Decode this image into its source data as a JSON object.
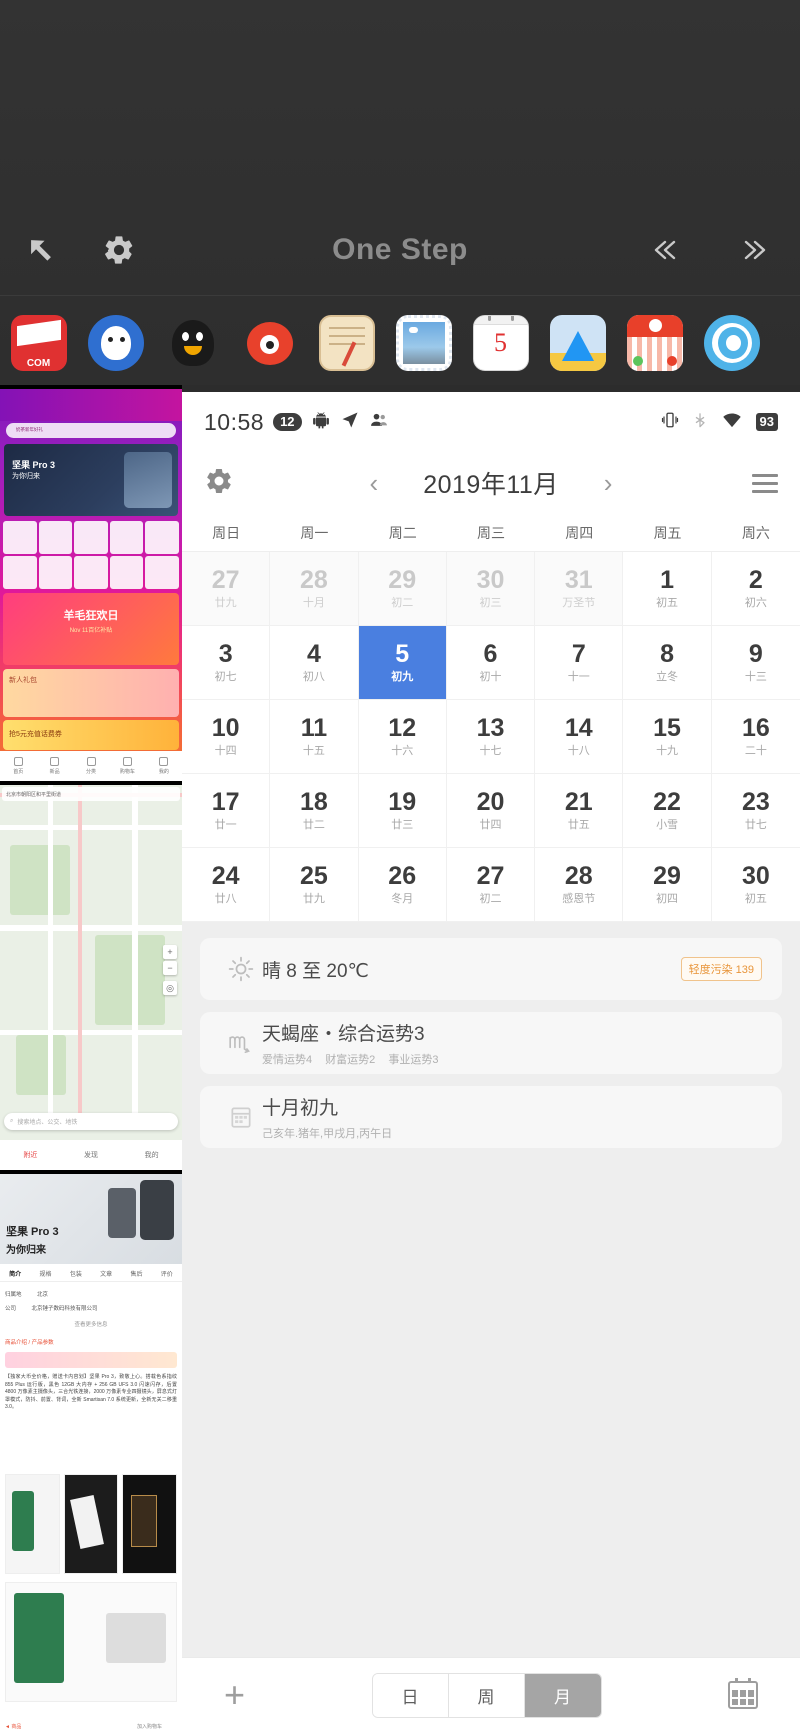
{
  "onestep": {
    "title": "One Step",
    "icons": {
      "back": "arrow-up-left-icon",
      "settings": "gear-icon",
      "prev": "double-chevron-left-icon",
      "next": "double-chevron-right-icon"
    },
    "dock": [
      {
        "name": "jd-com",
        "label": "COM"
      },
      {
        "name": "jd-dog",
        "label": ""
      },
      {
        "name": "qq",
        "label": ""
      },
      {
        "name": "weibo",
        "label": ""
      },
      {
        "name": "notes",
        "label": ""
      },
      {
        "name": "photos",
        "label": ""
      },
      {
        "name": "calendar",
        "label": "5"
      },
      {
        "name": "amap",
        "label": ""
      },
      {
        "name": "taobao",
        "label": ""
      },
      {
        "name": "browser",
        "label": ""
      }
    ]
  },
  "strip": {
    "shop": {
      "search_placeholder": "奶茶新年好礼",
      "banner_title": "坚果 Pro 3",
      "banner_sub": "为你归来",
      "promo_title": "羊毛狂欢日",
      "promo_sub": "Nov 11百亿补贴",
      "promo2": "新人礼包",
      "promo3": "抢5元充值话费券",
      "tabs": [
        "首页",
        "新品",
        "分类",
        "购物车",
        "我的"
      ]
    },
    "map": {
      "search_placeholder": "搜索地点、公交、地铁",
      "tabs": [
        "附近",
        "发现",
        "我的"
      ]
    },
    "news": {
      "hero_title": "坚果 Pro 3",
      "hero_sub": "为你归来",
      "tabs": [
        "简介",
        "规格",
        "包装",
        "文章",
        "售后",
        "评价"
      ],
      "row1_label": "归属地",
      "row1_value": "北京",
      "row2_label": "公司",
      "row2_value": "北京锤子数码科技有限公司",
      "row3": "查看更多信息",
      "section": "商品介绍 / 产品参数",
      "body": "【独家大币全价格，赠送卡内容划】坚果 Pro 3，致敬上心。搭载色系指纹 855 Plus 运行版，黑色 12GB 大内存 + 256 GB UFS 3.0 闪速闪存，后置 4800 万像素主摄像头，三合光铁连接，2000 万像素专业四摄镜头，屏息式灯罩模式，防抖、前置、背词，全新 Smartisan 7.0 系统更新，全新无关二移重 3.0。"
    }
  },
  "statusbar": {
    "time": "10:58",
    "badge": "12",
    "icons": [
      "android-icon",
      "location-arrow-icon",
      "contacts-icon"
    ],
    "right_icons": [
      "vibrate-icon",
      "bluetooth-icon",
      "wifi-icon"
    ],
    "battery": "93"
  },
  "calendar": {
    "gear": "gear-icon",
    "prev": "chevron-left-icon",
    "next": "chevron-right-icon",
    "menu": "hamburger-menu-icon",
    "title": "2019年11月",
    "weekdays": [
      "周日",
      "周一",
      "周二",
      "周三",
      "周四",
      "周五",
      "周六"
    ],
    "selected_color": "#4a7fe0",
    "days": [
      {
        "num": "27",
        "lunar": "廿九",
        "out": true
      },
      {
        "num": "28",
        "lunar": "十月",
        "out": true
      },
      {
        "num": "29",
        "lunar": "初二",
        "out": true
      },
      {
        "num": "30",
        "lunar": "初三",
        "out": true
      },
      {
        "num": "31",
        "lunar": "万圣节",
        "out": true
      },
      {
        "num": "1",
        "lunar": "初五",
        "out": false
      },
      {
        "num": "2",
        "lunar": "初六",
        "out": false
      },
      {
        "num": "3",
        "lunar": "初七",
        "out": false
      },
      {
        "num": "4",
        "lunar": "初八",
        "out": false
      },
      {
        "num": "5",
        "lunar": "初九",
        "out": false,
        "selected": true
      },
      {
        "num": "6",
        "lunar": "初十",
        "out": false
      },
      {
        "num": "7",
        "lunar": "十一",
        "out": false
      },
      {
        "num": "8",
        "lunar": "立冬",
        "out": false
      },
      {
        "num": "9",
        "lunar": "十三",
        "out": false
      },
      {
        "num": "10",
        "lunar": "十四",
        "out": false
      },
      {
        "num": "11",
        "lunar": "十五",
        "out": false
      },
      {
        "num": "12",
        "lunar": "十六",
        "out": false
      },
      {
        "num": "13",
        "lunar": "十七",
        "out": false
      },
      {
        "num": "14",
        "lunar": "十八",
        "out": false
      },
      {
        "num": "15",
        "lunar": "十九",
        "out": false
      },
      {
        "num": "16",
        "lunar": "二十",
        "out": false
      },
      {
        "num": "17",
        "lunar": "廿一",
        "out": false
      },
      {
        "num": "18",
        "lunar": "廿二",
        "out": false
      },
      {
        "num": "19",
        "lunar": "廿三",
        "out": false
      },
      {
        "num": "20",
        "lunar": "廿四",
        "out": false
      },
      {
        "num": "21",
        "lunar": "廿五",
        "out": false
      },
      {
        "num": "22",
        "lunar": "小雪",
        "out": false
      },
      {
        "num": "23",
        "lunar": "廿七",
        "out": false
      },
      {
        "num": "24",
        "lunar": "廿八",
        "out": false
      },
      {
        "num": "25",
        "lunar": "廿九",
        "out": false
      },
      {
        "num": "26",
        "lunar": "冬月",
        "out": false
      },
      {
        "num": "27",
        "lunar": "初二",
        "out": false
      },
      {
        "num": "28",
        "lunar": "感恩节",
        "out": false
      },
      {
        "num": "29",
        "lunar": "初四",
        "out": false
      },
      {
        "num": "30",
        "lunar": "初五",
        "out": false
      }
    ]
  },
  "info": {
    "weather": {
      "icon": "sun-icon",
      "title": "晴  8 至 20℃",
      "aqi": "轻度污染 139",
      "aqi_color": "#e8953a"
    },
    "horoscope": {
      "icon": "scorpio-icon",
      "title": "天蝎座・综合运势3",
      "sub": [
        "爱情运势4",
        "财富运势2",
        "事业运势3"
      ]
    },
    "lunar": {
      "icon": "calendar-day-icon",
      "title": "十月初九",
      "sub": "己亥年.猪年,甲戌月,丙午日"
    }
  },
  "tabbar": {
    "add": "plus-icon",
    "segments": [
      {
        "label": "日",
        "active": false
      },
      {
        "label": "周",
        "active": false
      },
      {
        "label": "月",
        "active": true
      }
    ],
    "today": "calendar-icon"
  }
}
